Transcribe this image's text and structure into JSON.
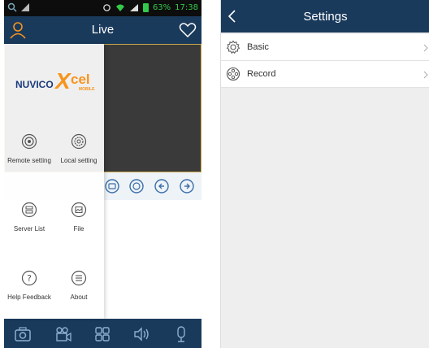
{
  "status_bar": {
    "battery_percent": "63%",
    "time": "17:38"
  },
  "live_screen": {
    "title": "Live",
    "drawer": {
      "logo_text_nuvico": "NUVICO",
      "logo_text_x": "X",
      "logo_text_cel": "cel",
      "logo_text_mobile": "MOBILE",
      "items": [
        {
          "label": "Remote setting",
          "icon": "remote-setting-icon"
        },
        {
          "label": "Local setting",
          "icon": "local-setting-icon"
        },
        {
          "label": "Server List",
          "icon": "server-list-icon"
        },
        {
          "label": "File",
          "icon": "file-icon"
        },
        {
          "label": "Help Feedback",
          "icon": "help-icon"
        },
        {
          "label": "About",
          "icon": "about-icon"
        }
      ]
    },
    "bottom_bar_icons": [
      "snapshot-icon",
      "record-video-icon",
      "grid-layout-icon",
      "audio-icon",
      "talk-microphone-icon"
    ]
  },
  "settings_screen": {
    "title": "Settings",
    "rows": [
      {
        "label": "Basic",
        "icon": "gear-icon"
      },
      {
        "label": "Record",
        "icon": "film-reel-icon"
      }
    ]
  },
  "colors": {
    "header_bg": "#1a3a5c",
    "accent_orange": "#f7941d",
    "status_green": "#33c94b"
  }
}
